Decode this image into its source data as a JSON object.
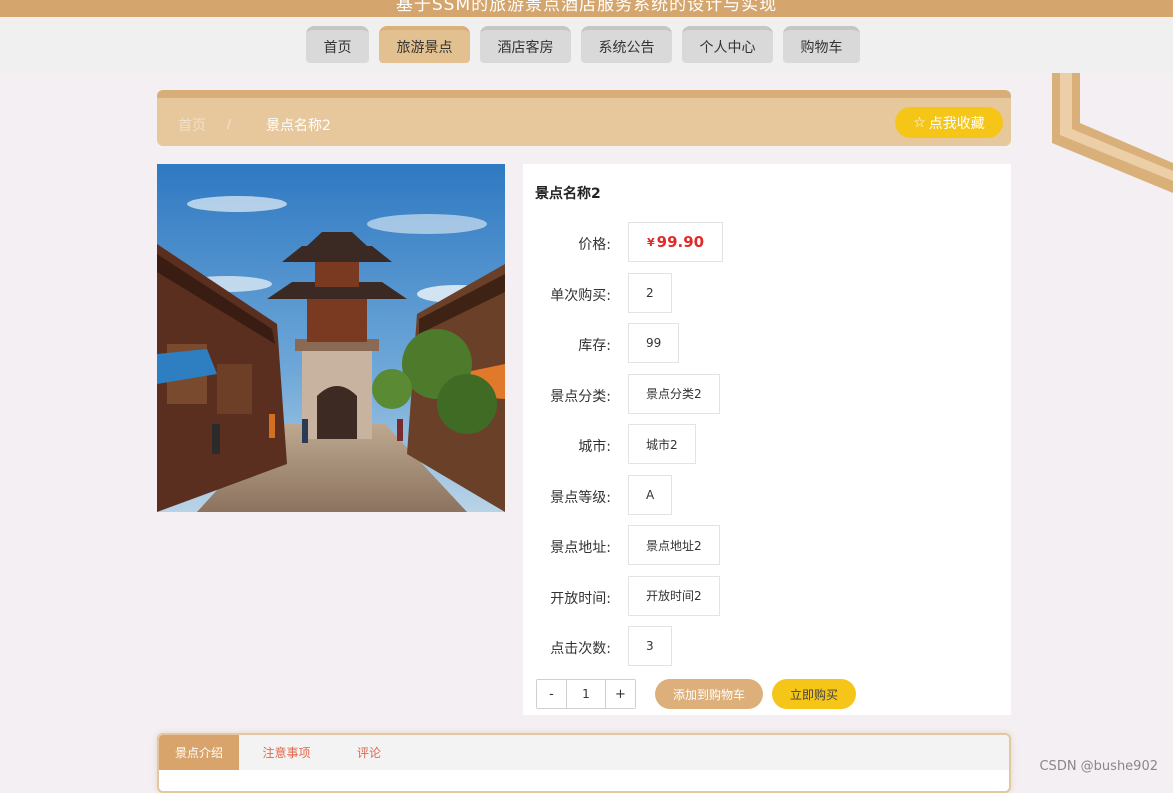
{
  "header": {
    "title": "基于SSM的旅游景点酒店服务系统的设计与实现"
  },
  "nav": {
    "items": [
      {
        "label": "首页",
        "width": 63
      },
      {
        "label": "旅游景点",
        "width": 91,
        "active": true
      },
      {
        "label": "酒店客房",
        "width": 91
      },
      {
        "label": "系统公告",
        "width": 91
      },
      {
        "label": "个人中心",
        "width": 91
      },
      {
        "label": "购物车",
        "width": 77
      }
    ]
  },
  "breadcrumb": {
    "home": "首页",
    "separator": "/",
    "current": "景点名称2",
    "favorite_label": "点我收藏"
  },
  "detail": {
    "title": "景点名称2",
    "currency": "¥",
    "fields": [
      {
        "label": "价格:",
        "value": "99.90",
        "type": "price"
      },
      {
        "label": "单次购买:",
        "value": "2"
      },
      {
        "label": "库存:",
        "value": "99"
      },
      {
        "label": "景点分类:",
        "value": "景点分类2"
      },
      {
        "label": "城市:",
        "value": "城市2"
      },
      {
        "label": "景点等级:",
        "value": "A"
      },
      {
        "label": "景点地址:",
        "value": "景点地址2"
      },
      {
        "label": "开放时间:",
        "value": "开放时间2"
      },
      {
        "label": "点击次数:",
        "value": "3"
      }
    ],
    "quantity": {
      "minus": "-",
      "value": "1",
      "plus": "+"
    },
    "add_to_cart_label": "添加到购物车",
    "buy_now_label": "立即购买"
  },
  "tabs": [
    {
      "label": "景点介绍",
      "active": true
    },
    {
      "label": "注意事项"
    },
    {
      "label": "评论"
    }
  ],
  "watermark": "CSDN @bushe902",
  "colors": {
    "accent": "#d4a56c",
    "accent_light": "#e7c89c",
    "yellow": "#f5c518",
    "price_red": "#e02b2b"
  }
}
